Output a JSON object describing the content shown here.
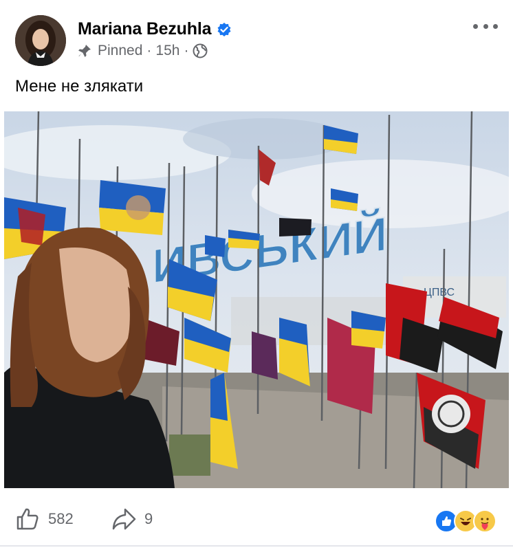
{
  "post": {
    "author": "Mariana Bezuhla",
    "verified_icon": "verified-badge-icon",
    "pinned_label": "Pinned",
    "separator": "·",
    "time": "15h",
    "audience_icon": "globe-icon",
    "text": "Мене не злякати"
  },
  "photo": {
    "sign_text": "ИВСЬКИЙ",
    "partial_sign_text": "ЦПВС"
  },
  "footer": {
    "likes": "582",
    "shares": "9",
    "reaction_icons": [
      "like-reaction-icon",
      "haha-reaction-icon",
      "care-reaction-icon"
    ]
  },
  "colors": {
    "accent": "#1877f2",
    "muted": "#65676b",
    "ukraine_blue": "#1f5fc0",
    "ukraine_yellow": "#f3cf2a",
    "red": "#c7161b"
  }
}
